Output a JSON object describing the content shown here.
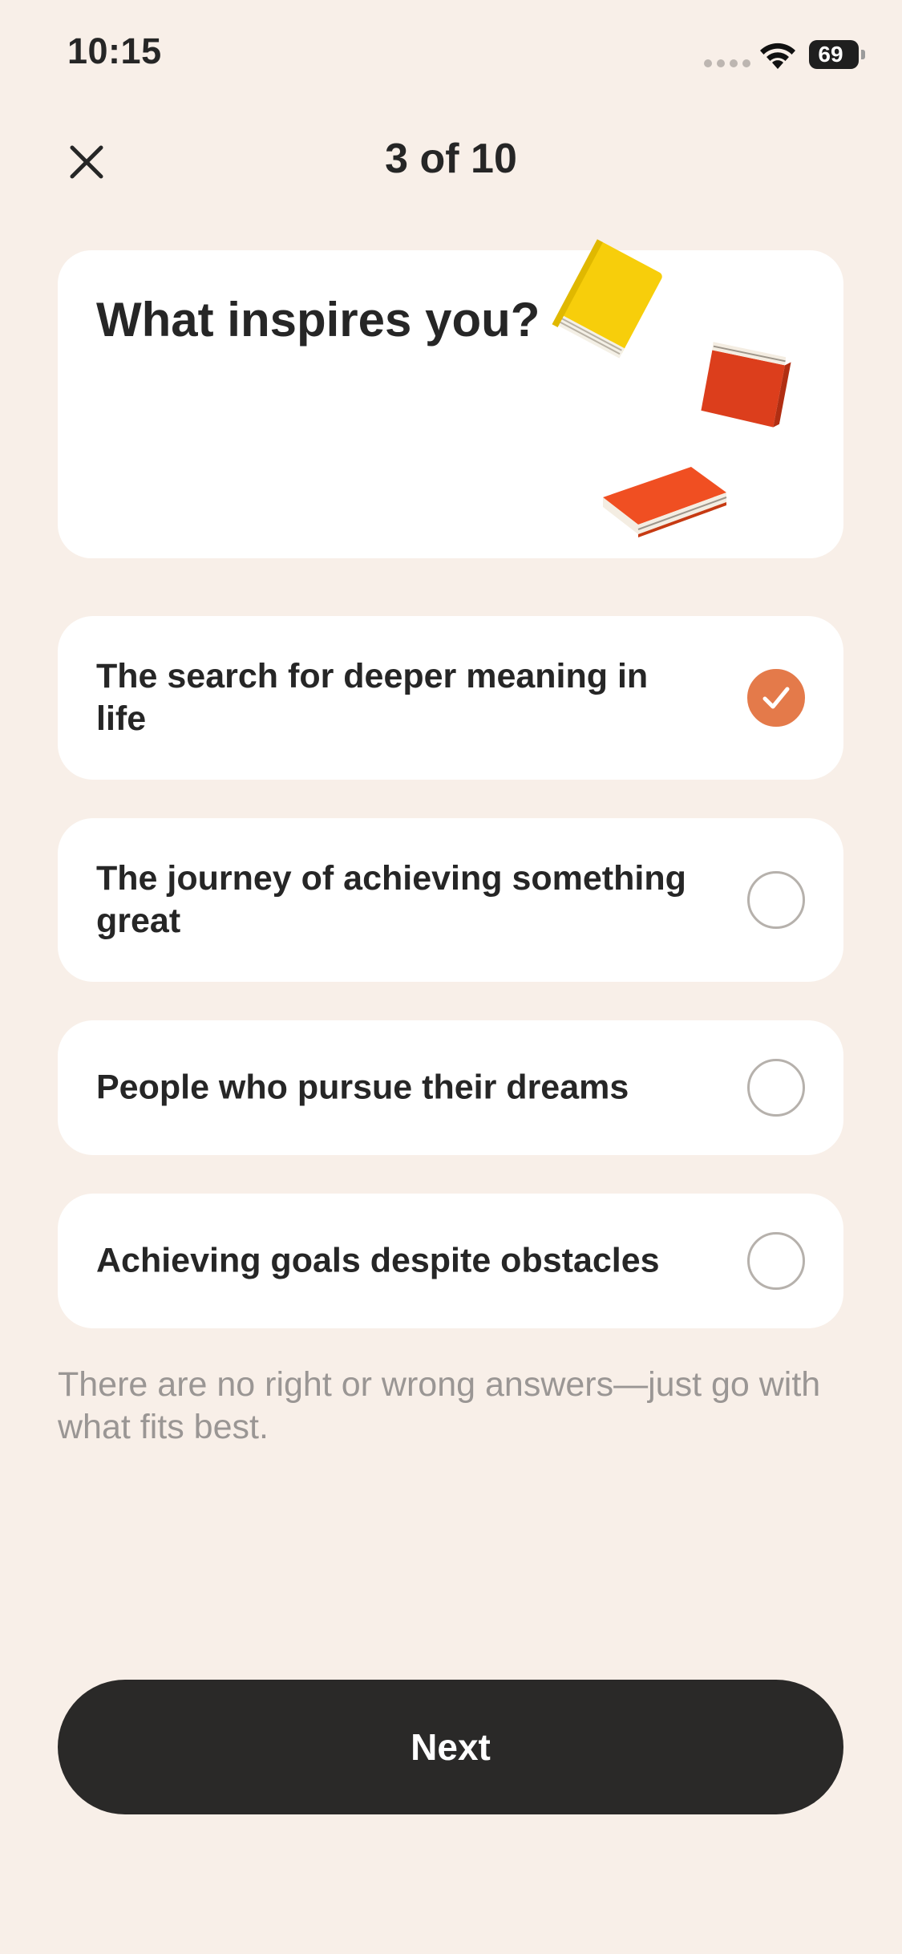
{
  "status_bar": {
    "time": "10:15",
    "battery_level": "69",
    "icons": [
      "cellular-signal-icon",
      "wifi-icon",
      "battery-icon"
    ]
  },
  "header": {
    "close_icon": "close-icon",
    "progress": "3 of 10"
  },
  "question": {
    "title": "What inspires you?",
    "illustration": "books-illustration"
  },
  "options": [
    {
      "label": "The search for deeper meaning in life",
      "selected": true
    },
    {
      "label": "The journey of achieving something great",
      "selected": false
    },
    {
      "label": "People who pursue their dreams",
      "selected": false
    },
    {
      "label": "Achieving goals despite obstacles",
      "selected": false
    }
  ],
  "hint": "There are no right or wrong answers—just go with what fits best.",
  "next_label": "Next",
  "colors": {
    "background": "#F8EFE8",
    "accent": "#E47A4A",
    "button": "#2A2928",
    "book_yellow": "#F7CE0B",
    "book_red": "#DC3E1C",
    "book_orange": "#F04F22"
  }
}
